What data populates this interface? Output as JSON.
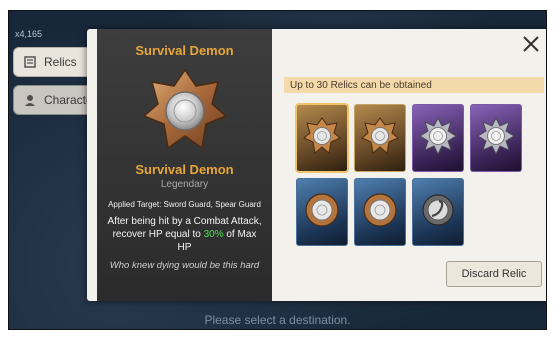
{
  "background": {
    "coords": "x4,165",
    "hint": "Please select a destination."
  },
  "sidebar": {
    "tabs": [
      {
        "label": "Relics",
        "icon": "relic-icon"
      },
      {
        "label": "Character",
        "icon": "character-icon"
      }
    ]
  },
  "detail": {
    "title": "Survival Demon",
    "name": "Survival Demon",
    "grade": "Legendary",
    "applied_target": "Applied Target: Sword Guard, Spear Guard",
    "description_pre": "After being hit by a Combat Attack, recover HP equal to ",
    "description_pct": "30%",
    "description_post": " of Max HP",
    "flavor": "Who knew dying would be this hard"
  },
  "inventory": {
    "limit_text": "Up to 30 Relics can be obtained",
    "relics": [
      {
        "rarity": "gold",
        "icon": "bronze-star-emblem-icon",
        "selected": true
      },
      {
        "rarity": "gold",
        "icon": "bronze-star-emblem-icon",
        "selected": false
      },
      {
        "rarity": "purple",
        "icon": "silver-star-emblem-icon",
        "selected": false
      },
      {
        "rarity": "purple",
        "icon": "silver-star-emblem-icon",
        "selected": false
      },
      {
        "rarity": "blue",
        "icon": "bronze-round-emblem-icon",
        "selected": false
      },
      {
        "rarity": "blue",
        "icon": "bronze-round-emblem-icon",
        "selected": false
      },
      {
        "rarity": "blue",
        "icon": "silver-hook-emblem-icon",
        "selected": false
      }
    ],
    "discard_label": "Discard Relic"
  },
  "colors": {
    "legendary": "#e8a63a",
    "highlight_pct": "#4ee04e",
    "limit_bar": "#f4d9ab"
  }
}
